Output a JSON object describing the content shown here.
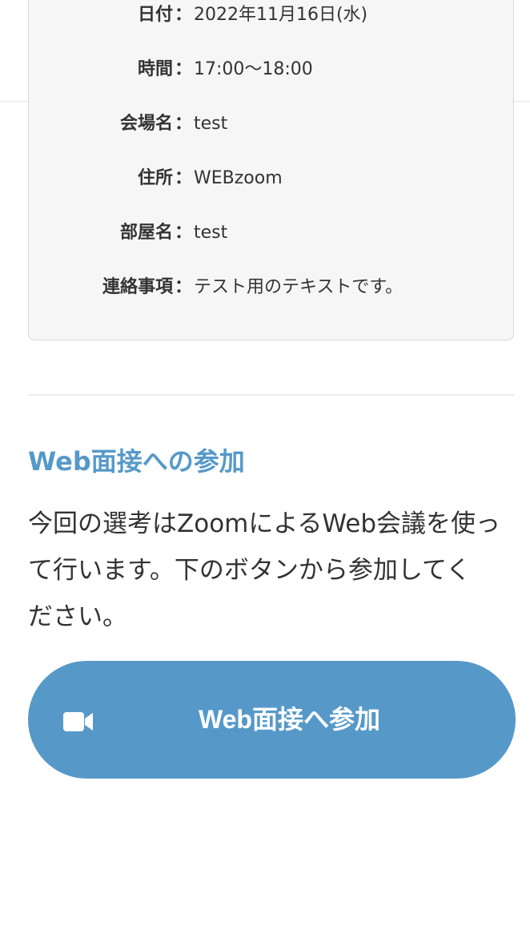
{
  "details": [
    {
      "label": "日付",
      "separator": "：",
      "value": "2022年11月16日(水)"
    },
    {
      "label": "時間",
      "separator": "：",
      "value": "17:00〜18:00"
    },
    {
      "label": "会場名",
      "separator": "：",
      "value": "test"
    },
    {
      "label": "住所",
      "separator": "：",
      "value": "WEBzoom"
    },
    {
      "label": "部屋名",
      "separator": "：",
      "value": "test"
    },
    {
      "label": "連絡事項",
      "separator": "：",
      "value": "テスト用のテキストです。"
    }
  ],
  "section": {
    "title": "Web面接への参加",
    "text_lines": [
      "今回の選考はZoomによるWeb会議を使っ",
      "て行います。下のボタンから参加してく",
      "ださい。"
    ]
  },
  "join_button": {
    "label": "Web面接へ参加",
    "icon": "video-camera-icon"
  },
  "colors": {
    "accent": "#5699c9",
    "card_background": "#f6f6f6",
    "text": "#333333"
  }
}
